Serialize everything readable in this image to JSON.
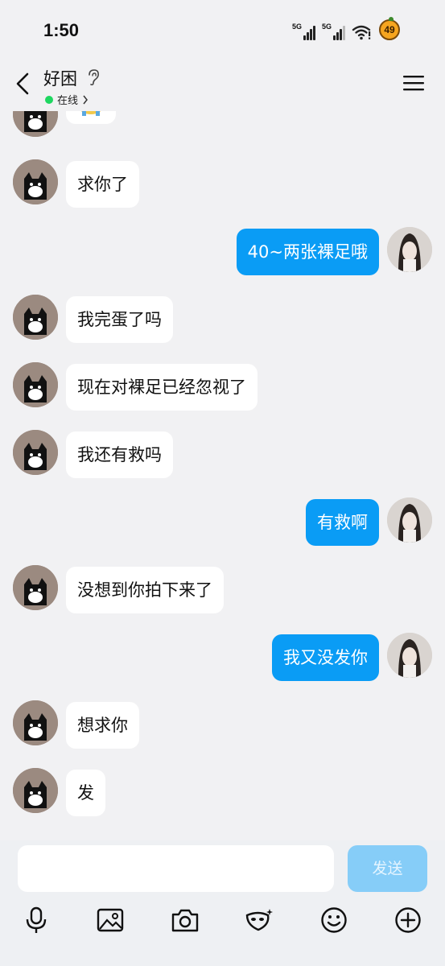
{
  "status_bar": {
    "time": "1:50",
    "network_1": "5G",
    "network_2": "5G",
    "battery_badge": "49"
  },
  "header": {
    "title": "好困",
    "status": "在线",
    "status_color": "#1ed760"
  },
  "messages": [
    {
      "side": "in",
      "text": "求你了"
    },
    {
      "side": "out",
      "text": "40~两张裸足哦"
    },
    {
      "side": "in",
      "text": "我完蛋了吗"
    },
    {
      "side": "in",
      "text": "现在对裸足已经忽视了"
    },
    {
      "side": "in",
      "text": "我还有救吗"
    },
    {
      "side": "out",
      "text": "有救啊"
    },
    {
      "side": "in",
      "text": "没想到你拍下来了"
    },
    {
      "side": "out",
      "text": "我又没发你"
    },
    {
      "side": "in",
      "text": "想求你"
    },
    {
      "side": "in",
      "text": "发"
    }
  ],
  "input": {
    "value": "",
    "placeholder": "",
    "send_label": "发送"
  },
  "toolbar": {
    "icons": [
      "microphone-icon",
      "image-icon",
      "camera-icon",
      "sticker-mask-icon",
      "emoji-icon",
      "plus-icon"
    ]
  },
  "colors": {
    "outgoing_bubble": "#0a9cf5",
    "incoming_bubble": "#ffffff",
    "background": "#f1f1f3",
    "send_button": "#86cdf8"
  }
}
